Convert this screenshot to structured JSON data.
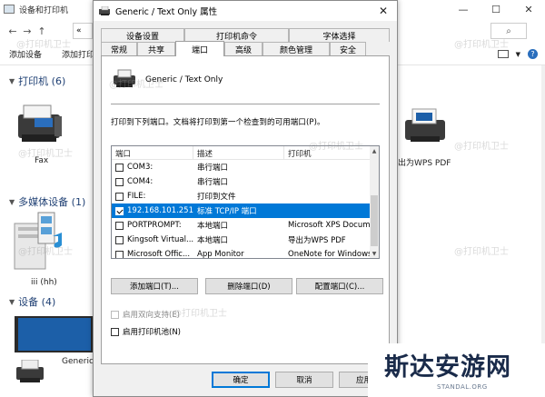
{
  "background_window": {
    "title": "设备和打印机",
    "crumb": "«",
    "toolbar": [
      "添加设备",
      "添加打印"
    ],
    "sections": {
      "printers": "打印机 (6)",
      "media": "多媒体设备 (1)",
      "devices": "设备 (4)"
    },
    "labels": {
      "fax": "Fax",
      "wps_pdf": "出为WPS PDF",
      "media_device": "iii (hh)",
      "generic": "Generic"
    }
  },
  "dialog": {
    "title": "Generic / Text Only 属性",
    "close": "✕",
    "tabs_top": [
      "设备设置",
      "打印机命令",
      "字体选择"
    ],
    "tabs_bottom": [
      "常规",
      "共享",
      "端口",
      "高级",
      "颜色管理",
      "安全"
    ],
    "active_tab": "端口",
    "printer_name": "Generic / Text Only",
    "hint": "打印到下列端口。文档将打印到第一个检查到的可用端口(P)。",
    "port_list": {
      "headers": [
        "端口",
        "描述",
        "打印机"
      ],
      "rows": [
        {
          "port": "COM3:",
          "desc": "串行端口",
          "printer": "",
          "checked": false,
          "selected": false
        },
        {
          "port": "COM4:",
          "desc": "串行端口",
          "printer": "",
          "checked": false,
          "selected": false
        },
        {
          "port": "FILE:",
          "desc": "打印到文件",
          "printer": "",
          "checked": false,
          "selected": false
        },
        {
          "port": "192.168.101.251",
          "desc": "标准 TCP/IP 端口",
          "printer": "",
          "checked": true,
          "selected": true
        },
        {
          "port": "PORTPROMPT:",
          "desc": "本地端口",
          "printer": "Microsoft XPS Docum",
          "checked": false,
          "selected": false
        },
        {
          "port": "Kingsoft Virtual...",
          "desc": "本地端口",
          "printer": "导出为WPS PDF",
          "checked": false,
          "selected": false
        },
        {
          "port": "Microsoft Offic...",
          "desc": "App Monitor",
          "printer": "OneNote for Windows",
          "checked": false,
          "selected": false
        }
      ]
    },
    "buttons": {
      "add_port": "添加端口(T)...",
      "delete_port": "删除端口(D)",
      "config_port": "配置端口(C)...",
      "ok": "确定",
      "cancel": "取消",
      "apply": "应用"
    },
    "options": {
      "bidirectional": "启用双向支持(E)",
      "pooling": "启用打印机池(N)"
    }
  },
  "watermark": "@打印机卫士",
  "brand": {
    "name": "斯达安游网",
    "url": "STANDAL.ORG"
  },
  "colors": {
    "selection": "#0078d7",
    "section_text": "#1e3f73"
  }
}
